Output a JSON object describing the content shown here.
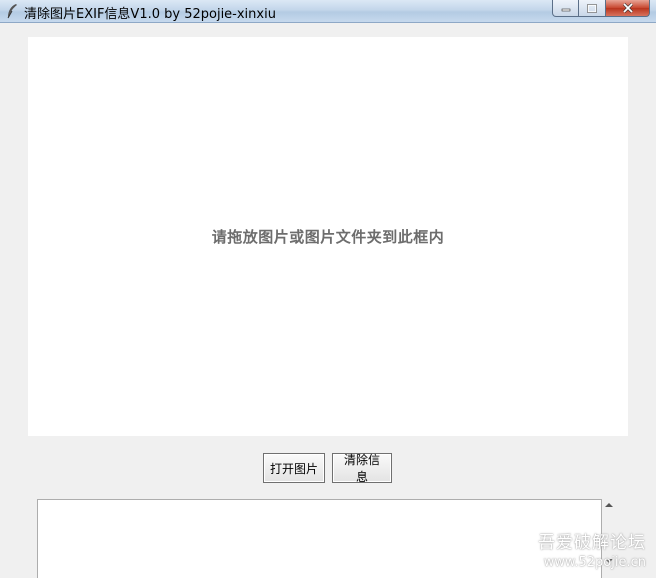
{
  "window": {
    "title": "清除图片EXIF信息V1.0 by 52pojie-xinxiu",
    "icon": "feather-icon"
  },
  "drop_zone": {
    "text": "请拖放图片或图片文件夹到此框内"
  },
  "buttons": {
    "open_label": "打开图片",
    "clear_label": "清除信息"
  },
  "info_box": {
    "value": ""
  },
  "watermark": {
    "line1": "吾爱破解论坛",
    "line2": "www.52pojie.cn"
  },
  "colors": {
    "close_button": "#c7462f",
    "titlebar": "#c3d6ea"
  }
}
